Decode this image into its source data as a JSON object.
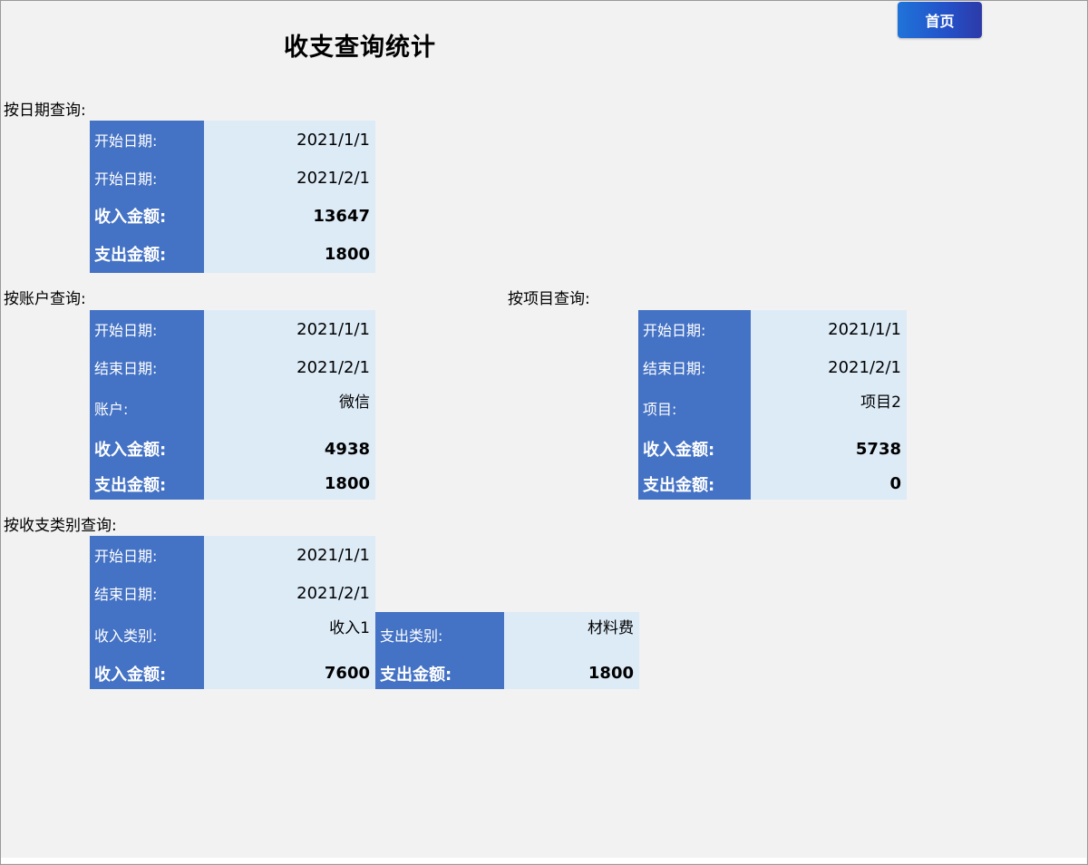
{
  "title": "收支查询统计",
  "home_button": "首页",
  "by_date": {
    "heading": "按日期查询:",
    "start_label": "开始日期:",
    "start_value": "2021/1/1",
    "end_label": "开始日期:",
    "end_value": "2021/2/1",
    "income_label": "收入金额:",
    "income_value": "13647",
    "expense_label": "支出金额:",
    "expense_value": "1800"
  },
  "by_account": {
    "heading": "按账户查询:",
    "start_label": "开始日期:",
    "start_value": "2021/1/1",
    "end_label": "结束日期:",
    "end_value": "2021/2/1",
    "account_label": "账户:",
    "account_value": "微信",
    "income_label": "收入金额:",
    "income_value": "4938",
    "expense_label": "支出金额:",
    "expense_value": "1800"
  },
  "by_project": {
    "heading": "按项目查询:",
    "start_label": "开始日期:",
    "start_value": "2021/1/1",
    "end_label": "结束日期:",
    "end_value": "2021/2/1",
    "project_label": "项目:",
    "project_value": "项目2",
    "income_label": "收入金额:",
    "income_value": "5738",
    "expense_label": "支出金额:",
    "expense_value": "0"
  },
  "by_category": {
    "heading": "按收支类别查询:",
    "start_label": "开始日期:",
    "start_value": "2021/1/1",
    "end_label": "结束日期:",
    "end_value": "2021/2/1",
    "income_cat_label": "收入类别:",
    "income_cat_value": "收入1",
    "income_label": "收入金额:",
    "income_value": "7600",
    "expense_cat_label": "支出类别:",
    "expense_cat_value": "材料费",
    "expense_label": "支出金额:",
    "expense_value": "1800"
  }
}
